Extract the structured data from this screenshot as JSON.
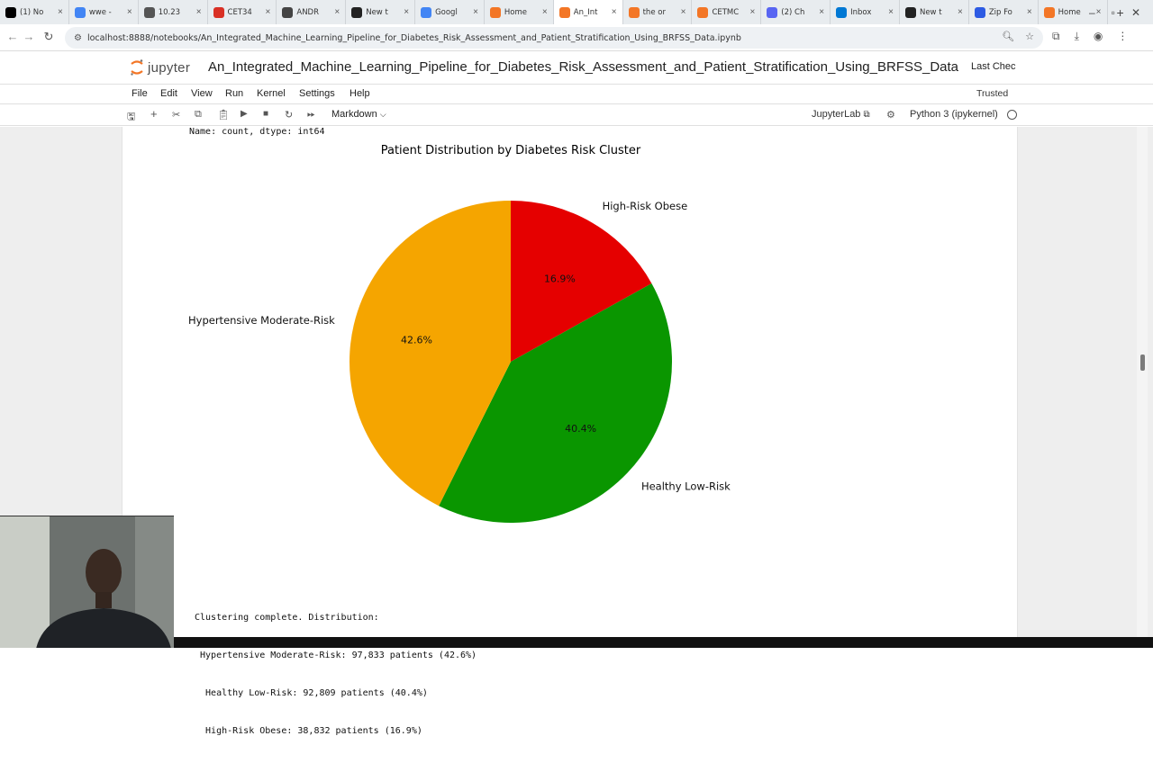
{
  "browser": {
    "tabs": [
      {
        "title": "(1) No",
        "icon": "x-icon",
        "color": "#000000"
      },
      {
        "title": "wwe -",
        "icon": "google-g-icon",
        "color": "#4285f4"
      },
      {
        "title": "10.23",
        "icon": "ai-icon",
        "color": "#555555"
      },
      {
        "title": "CET34",
        "icon": "target-icon",
        "color": "#d93025"
      },
      {
        "title": "ANDR",
        "icon": "globe-icon",
        "color": "#444444"
      },
      {
        "title": "New t",
        "icon": "github-icon",
        "color": "#222222"
      },
      {
        "title": "Googl",
        "icon": "google-g-icon",
        "color": "#4285f4"
      },
      {
        "title": "Home",
        "icon": "jupyter-icon",
        "color": "#f37626"
      },
      {
        "title": "An_Int",
        "icon": "jupyter-book-icon",
        "color": "#f37626",
        "active": true
      },
      {
        "title": "the or",
        "icon": "jupyter-book-icon",
        "color": "#f37626"
      },
      {
        "title": "CETMC",
        "icon": "jupyter-book-icon",
        "color": "#f37626"
      },
      {
        "title": "(2) Ch",
        "icon": "discord-icon",
        "color": "#5865f2"
      },
      {
        "title": "Inbox",
        "icon": "outlook-icon",
        "color": "#0078d4"
      },
      {
        "title": "New t",
        "icon": "github-icon",
        "color": "#222222"
      },
      {
        "title": "Zip Fo",
        "icon": "zip-icon",
        "color": "#2d5be3"
      },
      {
        "title": "Home",
        "icon": "jupyter-icon",
        "color": "#f37626"
      }
    ],
    "url": "localhost:8888/notebooks/An_Integrated_Machine_Learning_Pipeline_for_Diabetes_Risk_Assessment_and_Patient_Stratification_Using_BRFSS_Data.ipynb"
  },
  "jupyter": {
    "logo_text": "jupyter",
    "notebook_title": "An_Integrated_Machine_Learning_Pipeline_for_Diabetes_Risk_Assessment_and_Patient_Stratification_Using_BRFSS_Data",
    "last_checkpoint": "Last Chec",
    "menu": [
      "File",
      "Edit",
      "View",
      "Run",
      "Kernel",
      "Settings",
      "Help"
    ],
    "trusted": "Trusted",
    "cell_type": "Markdown",
    "jupyterlab_link": "JupyterLab",
    "kernel_name": "Python 3 (ipykernel)"
  },
  "output": {
    "pre_text": "Name: count, dtype: int64",
    "post_lines": [
      "Clustering complete. Distribution:",
      " Hypertensive Moderate-Risk: 97,833 patients (42.6%)",
      "  Healthy Low-Risk: 92,809 patients (40.4%)",
      "  High-Risk Obese: 38,832 patients (16.9%)"
    ]
  },
  "chart_data": {
    "type": "pie",
    "title": "Patient Distribution by Diabetes Risk Cluster",
    "slices": [
      {
        "label": "High-Risk Obese",
        "value": 16.9,
        "pct_label": "16.9%",
        "color": "#e50000"
      },
      {
        "label": "Healthy Low-Risk",
        "value": 40.4,
        "pct_label": "40.4%",
        "color": "#0a9600"
      },
      {
        "label": "Hypertensive Moderate-Risk",
        "value": 42.6,
        "pct_label": "42.6%",
        "color": "#f5a500"
      }
    ],
    "start_angle_deg": 90,
    "direction": "clockwise"
  }
}
